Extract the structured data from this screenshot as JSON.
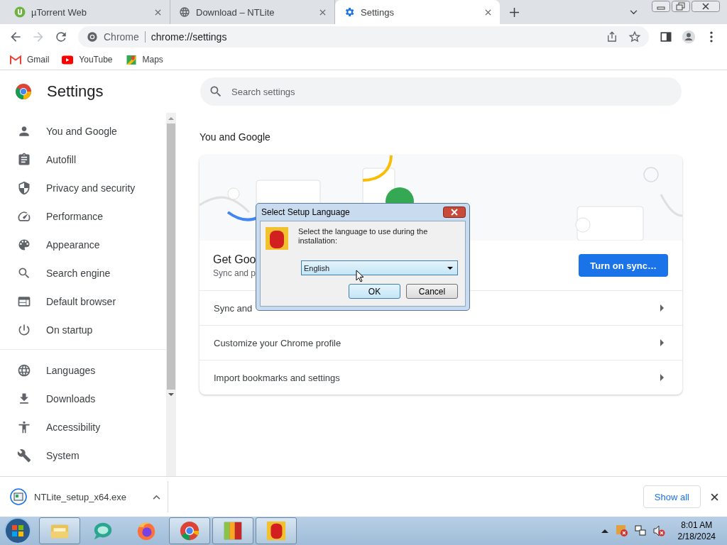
{
  "tabs": [
    {
      "title": "µTorrent Web",
      "kind": "utorrent",
      "selected": false
    },
    {
      "title": "Download – NTLite",
      "kind": "globe",
      "selected": false
    },
    {
      "title": "Settings",
      "kind": "gear",
      "selected": true
    }
  ],
  "toolbar": {
    "forward_disabled": true,
    "site_label": "Chrome",
    "url": "chrome://settings"
  },
  "bookmarks": [
    {
      "label": "Gmail",
      "kind": "gmail"
    },
    {
      "label": "YouTube",
      "kind": "youtube"
    },
    {
      "label": "Maps",
      "kind": "maps"
    }
  ],
  "settings": {
    "title": "Settings",
    "search_placeholder": "Search settings"
  },
  "sidebar": {
    "groups": [
      [
        {
          "label": "You and Google",
          "kind": "person",
          "selected": false
        },
        {
          "label": "Autofill",
          "kind": "autofill",
          "selected": false
        },
        {
          "label": "Privacy and security",
          "kind": "shield",
          "selected": false
        },
        {
          "label": "Performance",
          "kind": "speed",
          "selected": false
        },
        {
          "label": "Appearance",
          "kind": "palette",
          "selected": false
        },
        {
          "label": "Search engine",
          "kind": "search",
          "selected": false
        },
        {
          "label": "Default browser",
          "kind": "browser",
          "selected": false
        },
        {
          "label": "On startup",
          "kind": "power",
          "selected": false
        }
      ],
      [
        {
          "label": "Languages",
          "kind": "globe",
          "selected": false
        },
        {
          "label": "Downloads",
          "kind": "download",
          "selected": false
        },
        {
          "label": "Accessibility",
          "kind": "accessibility",
          "selected": false
        },
        {
          "label": "System",
          "kind": "wrench",
          "selected": false
        }
      ]
    ]
  },
  "section": {
    "title": "You and Google",
    "heading": "Get Goo",
    "subtitle": "Sync and p",
    "button": "Turn on sync…",
    "rows": [
      "Sync and",
      "Customize your Chrome profile",
      "Import bookmarks and settings"
    ]
  },
  "dialog": {
    "title": "Select Setup Language",
    "message": "Select the language to use during the installation:",
    "language": "English",
    "ok": "OK",
    "cancel": "Cancel"
  },
  "download_shelf": {
    "file": "NTLite_setup_x64.exe",
    "show_all": "Show all"
  },
  "taskbar": {
    "apps": [
      {
        "kind": "folder",
        "running": true
      },
      {
        "kind": "bubble",
        "running": false
      },
      {
        "kind": "firefox",
        "running": false
      },
      {
        "kind": "chrome",
        "running": true
      },
      {
        "kind": "avg",
        "running": true
      },
      {
        "kind": "redapp",
        "running": true
      }
    ],
    "time": "8:01 AM",
    "date": "2/18/2024"
  }
}
